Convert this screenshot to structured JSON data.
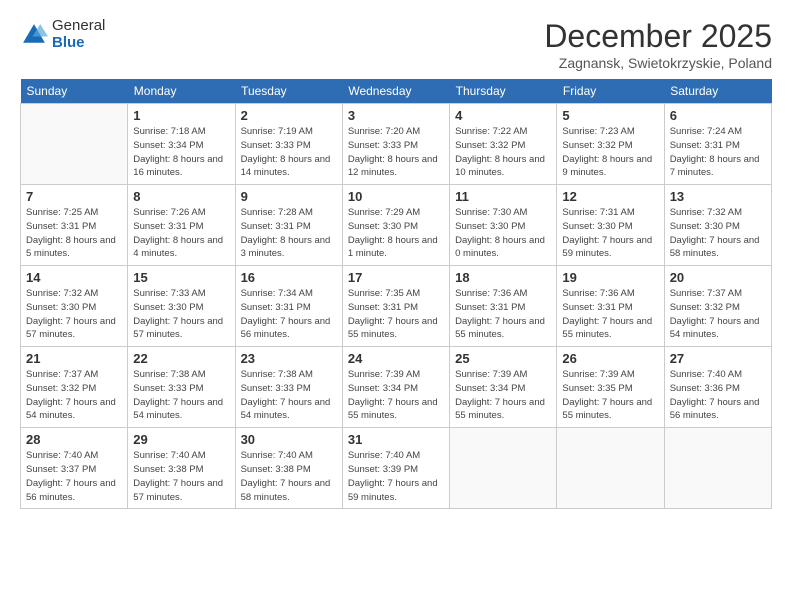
{
  "logo": {
    "general": "General",
    "blue": "Blue"
  },
  "header": {
    "month": "December 2025",
    "location": "Zagnansk, Swietokrzyskie, Poland"
  },
  "weekdays": [
    "Sunday",
    "Monday",
    "Tuesday",
    "Wednesday",
    "Thursday",
    "Friday",
    "Saturday"
  ],
  "weeks": [
    [
      {
        "day": null
      },
      {
        "day": 1,
        "rise": "7:18 AM",
        "set": "3:34 PM",
        "hours": "8 hours and 16 minutes."
      },
      {
        "day": 2,
        "rise": "7:19 AM",
        "set": "3:33 PM",
        "hours": "8 hours and 14 minutes."
      },
      {
        "day": 3,
        "rise": "7:20 AM",
        "set": "3:33 PM",
        "hours": "8 hours and 12 minutes."
      },
      {
        "day": 4,
        "rise": "7:22 AM",
        "set": "3:32 PM",
        "hours": "8 hours and 10 minutes."
      },
      {
        "day": 5,
        "rise": "7:23 AM",
        "set": "3:32 PM",
        "hours": "8 hours and 9 minutes."
      },
      {
        "day": 6,
        "rise": "7:24 AM",
        "set": "3:31 PM",
        "hours": "8 hours and 7 minutes."
      }
    ],
    [
      {
        "day": 7,
        "rise": "7:25 AM",
        "set": "3:31 PM",
        "hours": "8 hours and 5 minutes."
      },
      {
        "day": 8,
        "rise": "7:26 AM",
        "set": "3:31 PM",
        "hours": "8 hours and 4 minutes."
      },
      {
        "day": 9,
        "rise": "7:28 AM",
        "set": "3:31 PM",
        "hours": "8 hours and 3 minutes."
      },
      {
        "day": 10,
        "rise": "7:29 AM",
        "set": "3:30 PM",
        "hours": "8 hours and 1 minute."
      },
      {
        "day": 11,
        "rise": "7:30 AM",
        "set": "3:30 PM",
        "hours": "8 hours and 0 minutes."
      },
      {
        "day": 12,
        "rise": "7:31 AM",
        "set": "3:30 PM",
        "hours": "7 hours and 59 minutes."
      },
      {
        "day": 13,
        "rise": "7:32 AM",
        "set": "3:30 PM",
        "hours": "7 hours and 58 minutes."
      }
    ],
    [
      {
        "day": 14,
        "rise": "7:32 AM",
        "set": "3:30 PM",
        "hours": "7 hours and 57 minutes."
      },
      {
        "day": 15,
        "rise": "7:33 AM",
        "set": "3:30 PM",
        "hours": "7 hours and 57 minutes."
      },
      {
        "day": 16,
        "rise": "7:34 AM",
        "set": "3:31 PM",
        "hours": "7 hours and 56 minutes."
      },
      {
        "day": 17,
        "rise": "7:35 AM",
        "set": "3:31 PM",
        "hours": "7 hours and 55 minutes."
      },
      {
        "day": 18,
        "rise": "7:36 AM",
        "set": "3:31 PM",
        "hours": "7 hours and 55 minutes."
      },
      {
        "day": 19,
        "rise": "7:36 AM",
        "set": "3:31 PM",
        "hours": "7 hours and 55 minutes."
      },
      {
        "day": 20,
        "rise": "7:37 AM",
        "set": "3:32 PM",
        "hours": "7 hours and 54 minutes."
      }
    ],
    [
      {
        "day": 21,
        "rise": "7:37 AM",
        "set": "3:32 PM",
        "hours": "7 hours and 54 minutes."
      },
      {
        "day": 22,
        "rise": "7:38 AM",
        "set": "3:33 PM",
        "hours": "7 hours and 54 minutes."
      },
      {
        "day": 23,
        "rise": "7:38 AM",
        "set": "3:33 PM",
        "hours": "7 hours and 54 minutes."
      },
      {
        "day": 24,
        "rise": "7:39 AM",
        "set": "3:34 PM",
        "hours": "7 hours and 55 minutes."
      },
      {
        "day": 25,
        "rise": "7:39 AM",
        "set": "3:34 PM",
        "hours": "7 hours and 55 minutes."
      },
      {
        "day": 26,
        "rise": "7:39 AM",
        "set": "3:35 PM",
        "hours": "7 hours and 55 minutes."
      },
      {
        "day": 27,
        "rise": "7:40 AM",
        "set": "3:36 PM",
        "hours": "7 hours and 56 minutes."
      }
    ],
    [
      {
        "day": 28,
        "rise": "7:40 AM",
        "set": "3:37 PM",
        "hours": "7 hours and 56 minutes."
      },
      {
        "day": 29,
        "rise": "7:40 AM",
        "set": "3:38 PM",
        "hours": "7 hours and 57 minutes."
      },
      {
        "day": 30,
        "rise": "7:40 AM",
        "set": "3:38 PM",
        "hours": "7 hours and 58 minutes."
      },
      {
        "day": 31,
        "rise": "7:40 AM",
        "set": "3:39 PM",
        "hours": "7 hours and 59 minutes."
      },
      {
        "day": null
      },
      {
        "day": null
      },
      {
        "day": null
      }
    ]
  ]
}
